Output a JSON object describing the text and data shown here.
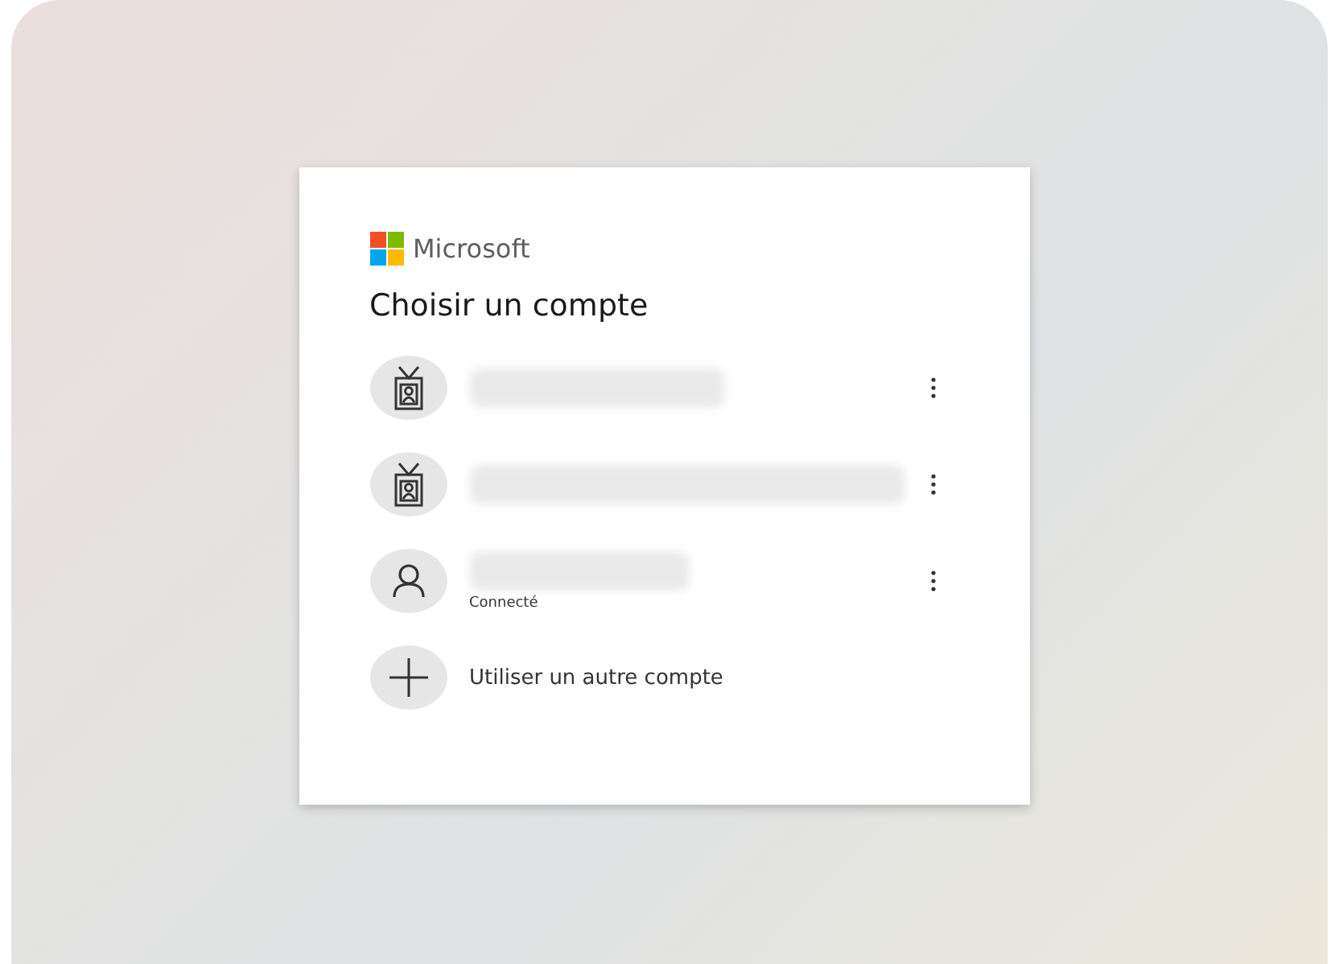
{
  "brand": {
    "name": "Microsoft"
  },
  "title": "Choisir un compte",
  "accounts": [
    {
      "kind": "work"
    },
    {
      "kind": "work"
    },
    {
      "kind": "personal",
      "status": "Connecté"
    }
  ],
  "add_account": {
    "label": "Utiliser un autre compte"
  }
}
